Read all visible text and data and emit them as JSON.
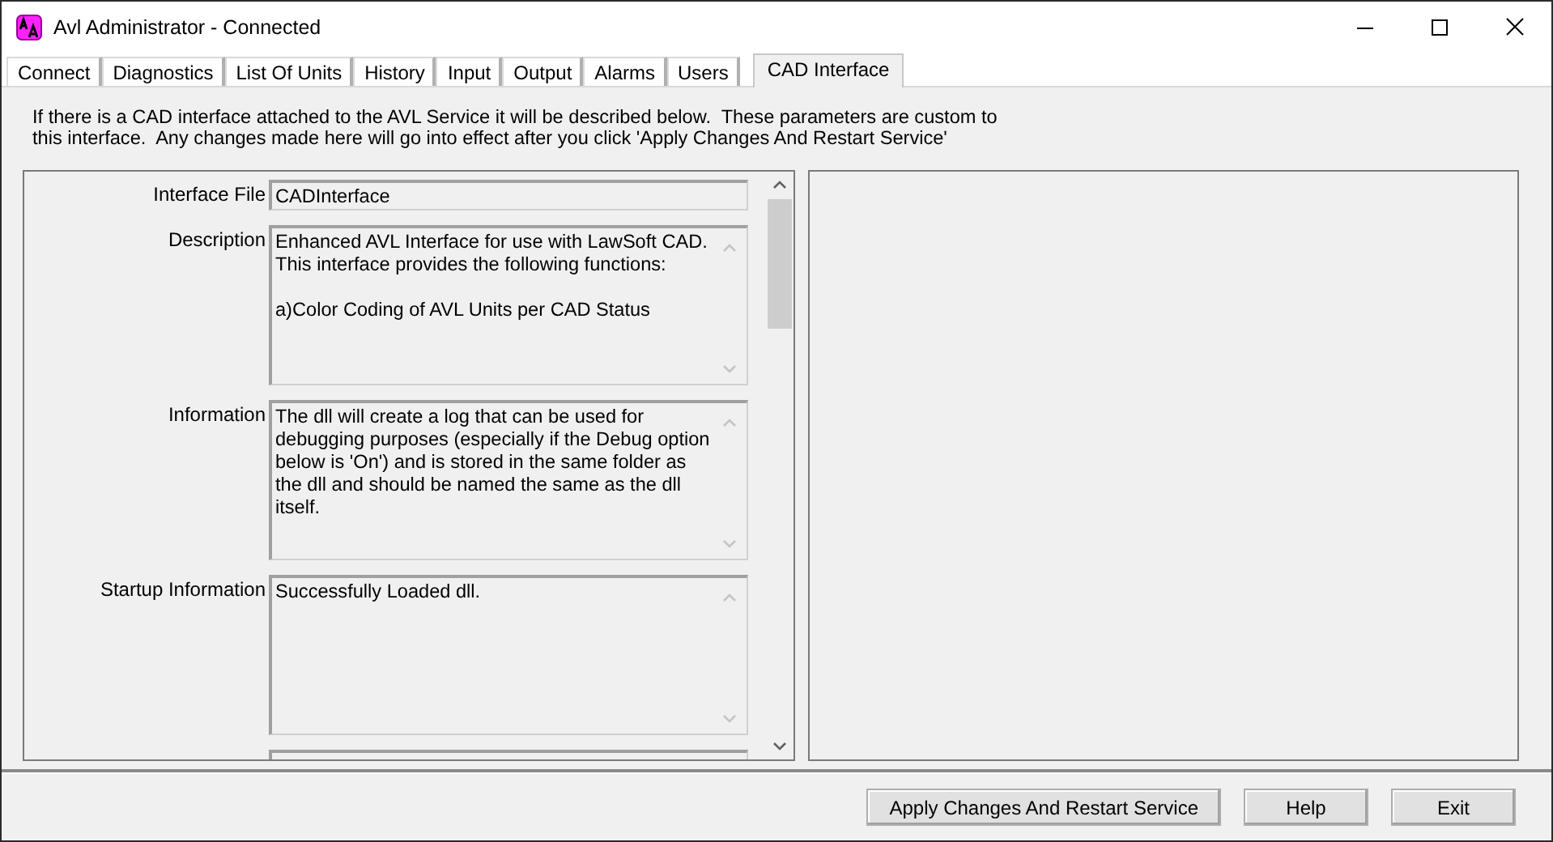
{
  "window": {
    "title": "Avl Administrator - Connected"
  },
  "tabs": [
    {
      "label": "Connect",
      "selected": false
    },
    {
      "label": "Diagnostics",
      "selected": false
    },
    {
      "label": "List Of Units",
      "selected": false
    },
    {
      "label": "History",
      "selected": false
    },
    {
      "label": "Input",
      "selected": false
    },
    {
      "label": "Output",
      "selected": false
    },
    {
      "label": "Alarms",
      "selected": false
    },
    {
      "label": "Users",
      "selected": false
    },
    {
      "label": "CAD Interface",
      "selected": true
    }
  ],
  "intro": "If there is a CAD interface attached to the AVL Service it will be described below.  These parameters are custom to this interface.  Any changes made here will go into effect after you click 'Apply Changes And Restart Service'",
  "fields": [
    {
      "label": "Interface File",
      "kind": "single",
      "value": "CADInterface"
    },
    {
      "label": "Description",
      "kind": "multi",
      "value": "Enhanced AVL Interface for use with LawSoft CAD.  This interface provides the following functions:\n\na)Color Coding of AVL Units per CAD Status"
    },
    {
      "label": "Information",
      "kind": "multi",
      "value": "The dll will create a log that can be used for debugging purposes (especially if the Debug option below is 'On') and is stored in the same folder as the dll and should be named the same as the dll itself."
    },
    {
      "label": "Startup Information",
      "kind": "multi",
      "value": "Successfully Loaded dll."
    }
  ],
  "buttons": [
    "Apply Changes And Restart Service",
    "Help",
    "Exit"
  ]
}
